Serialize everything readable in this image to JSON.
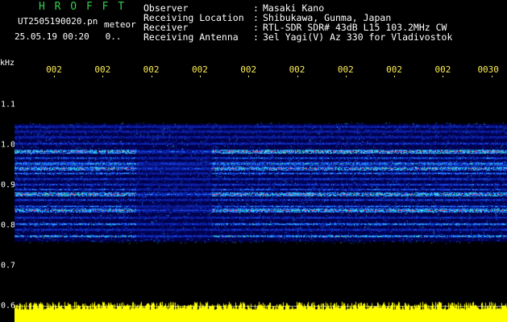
{
  "app": {
    "name": "H R O F F T"
  },
  "file": {
    "name": "UT2505190020.pn",
    "tag": "meteor"
  },
  "stamp": {
    "datetime": "25.05.19 00:20",
    "extra": "0.."
  },
  "header": {
    "rows": [
      {
        "label": "Observer",
        "sep": ":",
        "value": "Masaki Kano"
      },
      {
        "label": "Receiving Location",
        "sep": ":",
        "value": "Shibukawa, Gunma, Japan"
      },
      {
        "label": "Receiver",
        "sep": ":",
        "value": "RTL-SDR SDR# 43dB L15 103.2MHz CW"
      },
      {
        "label": "Receiving Antenna",
        "sep": ":",
        "value": "3el Yagi(V) Az 330 for Vladivostok"
      }
    ]
  },
  "axis": {
    "y_unit": "kHz",
    "y_ticks": [
      {
        "label": "1.1",
        "value": 1.1
      },
      {
        "label": "1.0",
        "value": 1.0
      },
      {
        "label": "0.9",
        "value": 0.9
      },
      {
        "label": "0.8",
        "value": 0.8
      },
      {
        "label": "0.7",
        "value": 0.7
      },
      {
        "label": "0.6",
        "value": 0.6
      }
    ],
    "x_ticks": [
      "002",
      "002",
      "002",
      "002",
      "002",
      "002",
      "002",
      "002",
      "002",
      "0030"
    ]
  },
  "colors": {
    "brand": "#35d04a",
    "xaxis": "#ffee55",
    "text": "#ffffff",
    "background": "#000000",
    "spectrogram_bg": "#00004a",
    "level_bar": "#ffff00"
  }
}
